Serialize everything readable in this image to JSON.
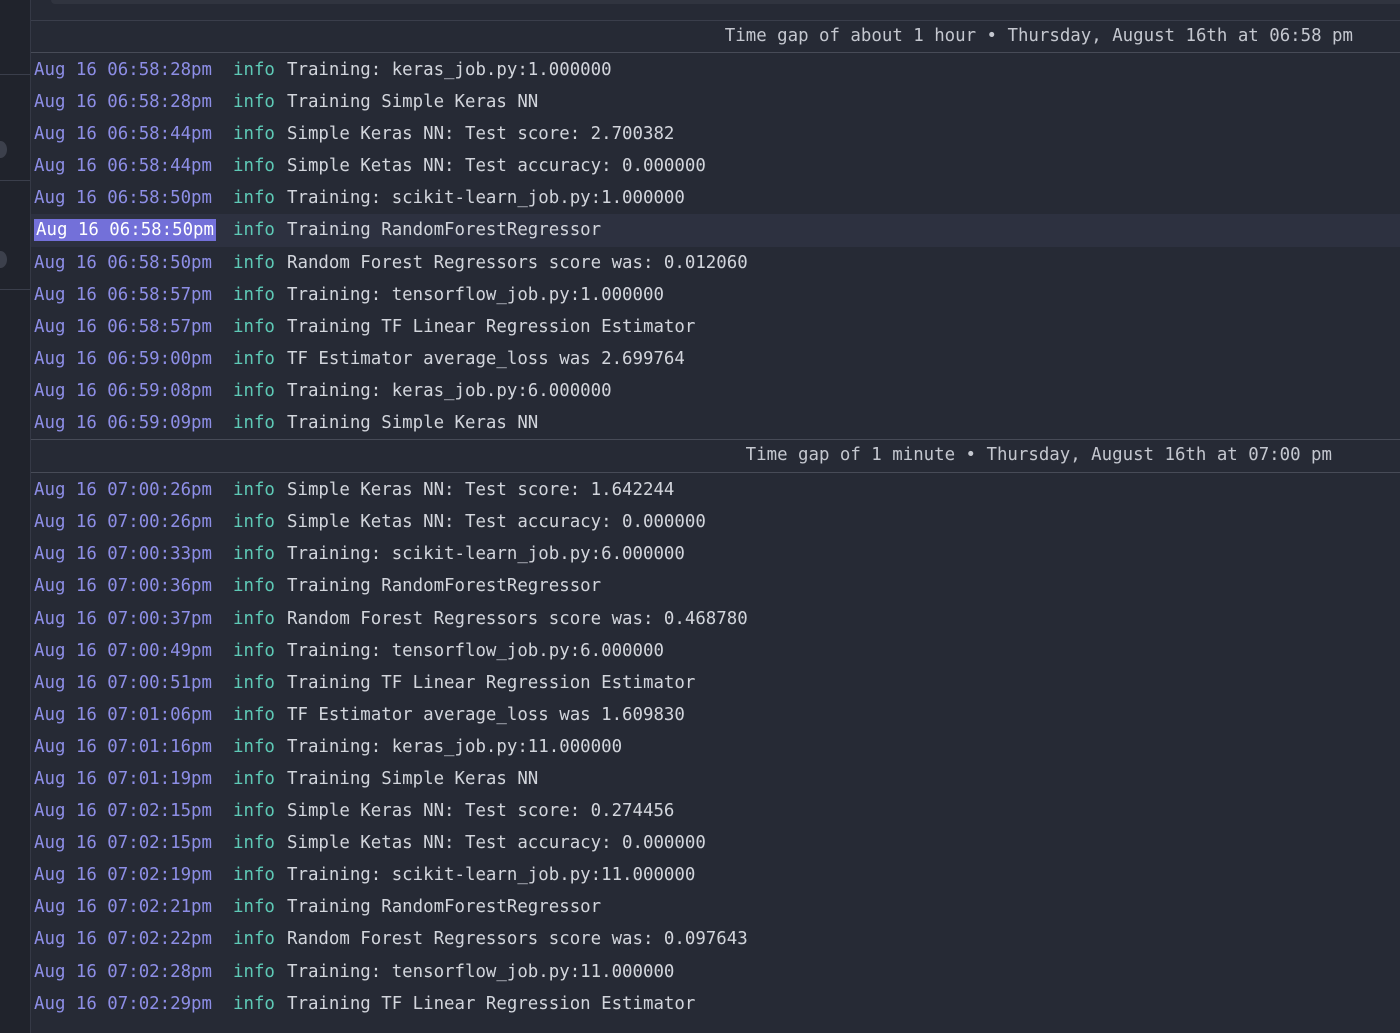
{
  "group1": {
    "gap_label": "Time gap of about 1 hour • Thursday, August 16th at 06:58 pm",
    "rows": [
      {
        "time": "Aug 16 06:58:28pm",
        "level": "info",
        "message": "Training: keras_job.py:1.000000"
      },
      {
        "time": "Aug 16 06:58:28pm",
        "level": "info",
        "message": "Training Simple Keras NN"
      },
      {
        "time": "Aug 16 06:58:44pm",
        "level": "info",
        "message": "Simple Keras NN: Test score: 2.700382"
      },
      {
        "time": "Aug 16 06:58:44pm",
        "level": "info",
        "message": "Simple Ketas NN: Test accuracy: 0.000000"
      },
      {
        "time": "Aug 16 06:58:50pm",
        "level": "info",
        "message": "Training: scikit-learn_job.py:1.000000"
      },
      {
        "time": "Aug 16 06:58:50pm",
        "level": "info",
        "message": "Training RandomForestRegressor",
        "selected": true
      },
      {
        "time": "Aug 16 06:58:50pm",
        "level": "info",
        "message": "Random Forest Regressors score was: 0.012060"
      },
      {
        "time": "Aug 16 06:58:57pm",
        "level": "info",
        "message": "Training: tensorflow_job.py:1.000000"
      },
      {
        "time": "Aug 16 06:58:57pm",
        "level": "info",
        "message": "Training TF Linear Regression Estimator"
      },
      {
        "time": "Aug 16 06:59:00pm",
        "level": "info",
        "message": "TF Estimator average_loss was 2.699764"
      },
      {
        "time": "Aug 16 06:59:08pm",
        "level": "info",
        "message": "Training: keras_job.py:6.000000"
      },
      {
        "time": "Aug 16 06:59:09pm",
        "level": "info",
        "message": "Training Simple Keras NN"
      }
    ]
  },
  "group2": {
    "gap_label": "Time gap of 1 minute • Thursday, August 16th at 07:00 pm",
    "rows": [
      {
        "time": "Aug 16 07:00:26pm",
        "level": "info",
        "message": "Simple Keras NN: Test score: 1.642244"
      },
      {
        "time": "Aug 16 07:00:26pm",
        "level": "info",
        "message": "Simple Ketas NN: Test accuracy: 0.000000"
      },
      {
        "time": "Aug 16 07:00:33pm",
        "level": "info",
        "message": "Training: scikit-learn_job.py:6.000000"
      },
      {
        "time": "Aug 16 07:00:36pm",
        "level": "info",
        "message": "Training RandomForestRegressor"
      },
      {
        "time": "Aug 16 07:00:37pm",
        "level": "info",
        "message": "Random Forest Regressors score was: 0.468780"
      },
      {
        "time": "Aug 16 07:00:49pm",
        "level": "info",
        "message": "Training: tensorflow_job.py:6.000000"
      },
      {
        "time": "Aug 16 07:00:51pm",
        "level": "info",
        "message": "Training TF Linear Regression Estimator"
      },
      {
        "time": "Aug 16 07:01:06pm",
        "level": "info",
        "message": "TF Estimator average_loss was 1.609830"
      },
      {
        "time": "Aug 16 07:01:16pm",
        "level": "info",
        "message": "Training: keras_job.py:11.000000"
      },
      {
        "time": "Aug 16 07:01:19pm",
        "level": "info",
        "message": "Training Simple Keras NN"
      },
      {
        "time": "Aug 16 07:02:15pm",
        "level": "info",
        "message": "Simple Keras NN: Test score: 0.274456"
      },
      {
        "time": "Aug 16 07:02:15pm",
        "level": "info",
        "message": "Simple Ketas NN: Test accuracy: 0.000000"
      },
      {
        "time": "Aug 16 07:02:19pm",
        "level": "info",
        "message": "Training: scikit-learn_job.py:11.000000"
      },
      {
        "time": "Aug 16 07:02:21pm",
        "level": "info",
        "message": "Training RandomForestRegressor"
      },
      {
        "time": "Aug 16 07:02:22pm",
        "level": "info",
        "message": "Random Forest Regressors score was: 0.097643"
      },
      {
        "time": "Aug 16 07:02:28pm",
        "level": "info",
        "message": "Training: tensorflow_job.py:11.000000"
      },
      {
        "time": "Aug 16 07:02:29pm",
        "level": "info",
        "message": "Training TF Linear Regression Estimator"
      }
    ]
  },
  "colors": {
    "background": "#262a35",
    "timestamp": "#8d8ee6",
    "level_info": "#5ec9b6",
    "message": "#d2d5dc",
    "selection": "#7370d9"
  }
}
